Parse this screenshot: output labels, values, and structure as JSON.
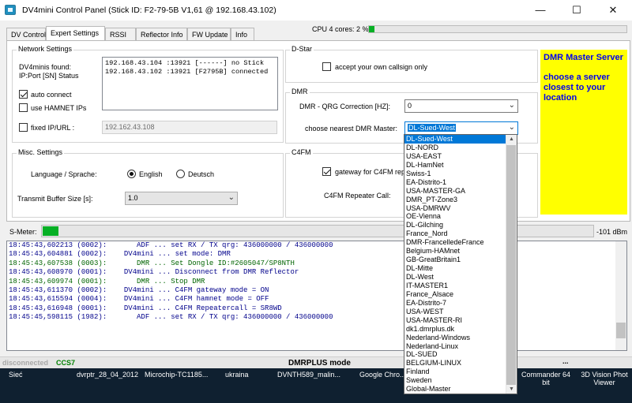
{
  "window": {
    "title": "DV4mini Control Panel (Stick ID: F2-79-5B V1,61 @ 192.168.43.102)",
    "minimize": "—",
    "maximize": "☐",
    "close": "✕"
  },
  "tabs": [
    "DV Control",
    "Expert Settings",
    "RSSI",
    "Reflector Info",
    "FW Update",
    "Info"
  ],
  "cpu": {
    "label": "CPU 4 cores: 2 %",
    "percent": 2
  },
  "network": {
    "group_label": "Network Settings",
    "found_label_1": "DV4minis found:",
    "found_label_2": "IP:Port [SN] Status",
    "found_list": "192.168.43.104 :13921 [------] no Stick\n192.168.43.102 :13921 [F2795B] connected",
    "auto_connect": "auto connect",
    "use_hamnet": "use HAMNET IPs",
    "fixed_ip": "fixed IP/URL :",
    "fixed_ip_value": "192.162.43.108"
  },
  "misc": {
    "group_label": "Misc. Settings",
    "language_label": "Language / Sprache:",
    "english": "English",
    "deutsch": "Deutsch",
    "buffer_label": "Transmit Buffer Size [s]:",
    "buffer_value": "1.0"
  },
  "dstar": {
    "group_label": "D-Star",
    "accept_own": "accept your own callsign only"
  },
  "dmr": {
    "group_label": "DMR",
    "qrg_label": "DMR - QRG Correction [HZ]:",
    "qrg_value": "0",
    "master_label": "choose nearest DMR Master:",
    "master_value": "DL-Sued-West"
  },
  "c4fm": {
    "group_label": "C4FM",
    "gateway": "gateway for C4FM repe",
    "repeater_call": "C4FM Repeater Call:"
  },
  "hint_box": {
    "title": "DMR Master Server",
    "text": "choose a server closest to your location"
  },
  "smeter": {
    "label": "S-Meter:",
    "value": "-101 dBm"
  },
  "log": [
    {
      "text": "18:45:43,602213 (0002):       ADF ... set RX / TX qrg: 436000000 / 436000000",
      "green": false
    },
    {
      "text": "18:45:43,604881 (0002):    DV4mini ... set mode: DMR",
      "green": false
    },
    {
      "text": "18:45:43,607538 (0003):       DMR ... Set Dongle ID:#2605047/SP8NTH",
      "green": true
    },
    {
      "text": "18:45:43,608970 (0001):    DV4mini ... Disconnect from DMR Reflector",
      "green": false
    },
    {
      "text": "18:45:43,609974 (0001):       DMR ... Stop DMR",
      "green": true
    },
    {
      "text": "18:45:43,611370 (0002):    DV4mini ... C4FM gateway mode = ON",
      "green": false
    },
    {
      "text": "18:45:43,615594 (0004):    DV4mini ... C4FM hamnet mode = OFF",
      "green": false
    },
    {
      "text": "18:45:43,616948 (0001):    DV4mini ... C4FM Repeatercall = SR8WD",
      "green": false
    },
    {
      "text": "18:45:45,598115 (1982):       ADF ... set RX / TX qrg: 436000000 / 436000000",
      "green": false
    }
  ],
  "status": {
    "connection": "disconnected",
    "ccs7": "CCS7",
    "mode": "DMRPLUS mode",
    "dots": "..."
  },
  "dropdown": {
    "selected": "DL-Sued-West",
    "items": [
      "DL-Sued-West",
      "DL-NORD",
      "USA-EAST",
      "DL-HamNet",
      "Swiss-1",
      "EA-Distrito-1",
      "USA-MASTER-GA",
      "DMR_PT-Zone3",
      "USA-DMRWV",
      "OE-Vienna",
      "DL-Gilching",
      "France_Nord",
      "DMR-FrancelledeFrance",
      "Belgium-HAMnet",
      "GB-GreatBritain1",
      "DL-Mitte",
      "DL-West",
      "IT-MASTER1",
      "France_Alsace",
      "EA-Distrito-7",
      "USA-WEST",
      "USA-MASTER-RI",
      "dk1.dmrplus.dk",
      "Nederland-Windows",
      "Nederland-Linux",
      "DL-SUED",
      "BELGIUM-LINUX",
      "Finland",
      "Sweden",
      "Global-Master"
    ]
  },
  "taskbar": [
    "Sieć",
    "dvrptr_28_04_2012",
    "Microchip-TC1185...",
    "ukraina",
    "DVNTH589_malin...",
    "Google Chro...",
    "Commander 64 bit",
    "3D Vision Phot Viewer"
  ],
  "colors": {
    "accent": "#0078d7",
    "progress": "#06b025",
    "hint_bg": "#ffff00",
    "hint_text": "#0000ee"
  }
}
